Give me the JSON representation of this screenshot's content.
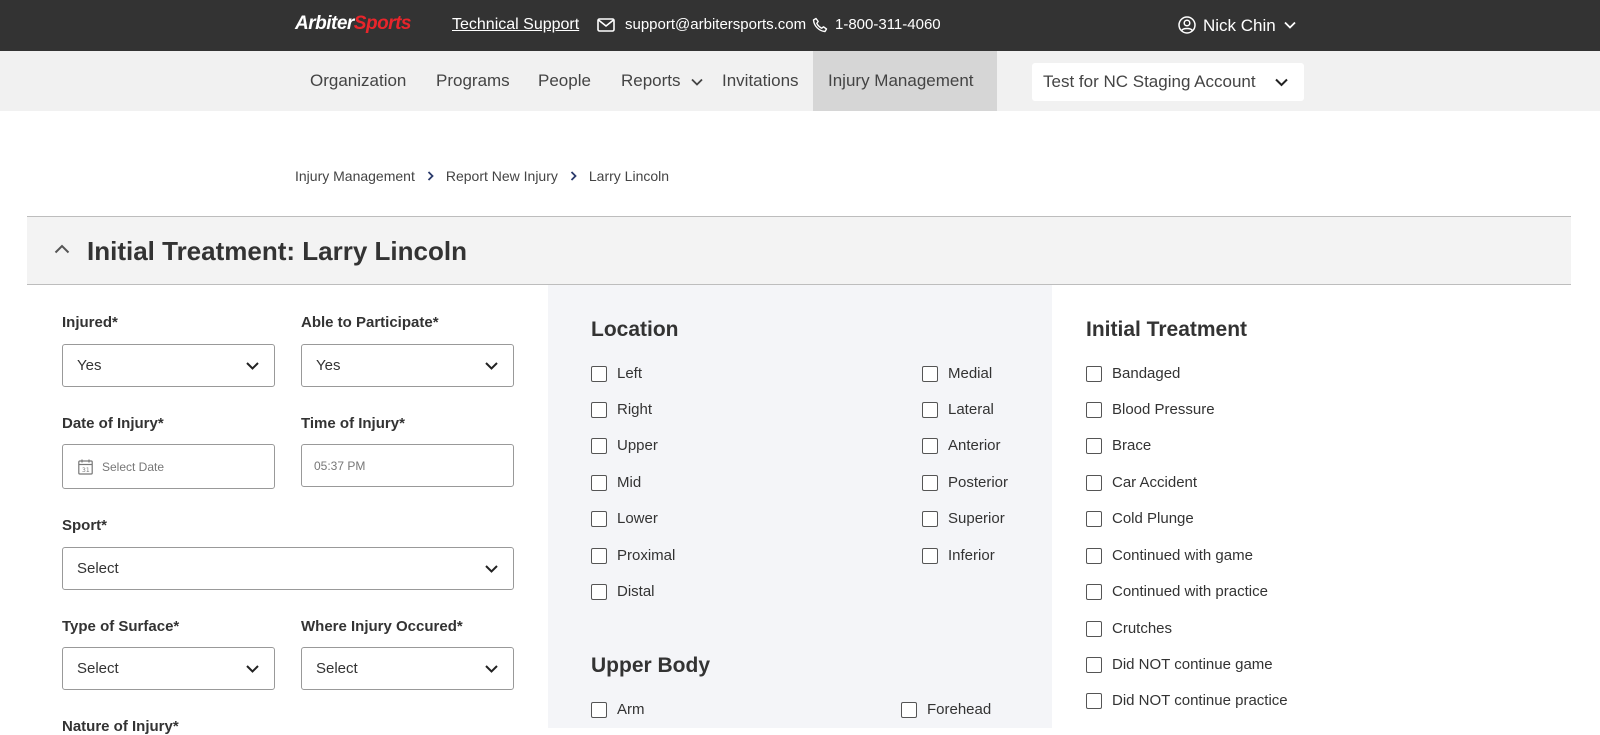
{
  "topbar": {
    "logo_part1": "Arbiter",
    "logo_part2": "Sports",
    "support_link": "Technical Support",
    "email": "support@arbitersports.com",
    "phone": "1-800-311-4060",
    "user_name": "Nick Chin"
  },
  "nav": {
    "items": [
      {
        "label": "Organization"
      },
      {
        "label": "Programs"
      },
      {
        "label": "People"
      },
      {
        "label": "Reports"
      },
      {
        "label": "Invitations"
      },
      {
        "label": "Injury Management"
      }
    ],
    "account": "Test for NC Staging Account"
  },
  "breadcrumb": [
    "Injury Management",
    "Report New Injury",
    "Larry Lincoln"
  ],
  "section": {
    "title": "Initial Treatment: Larry Lincoln"
  },
  "form": {
    "injured_label": "Injured*",
    "injured_value": "Yes",
    "able_label": "Able to Participate*",
    "able_value": "Yes",
    "date_label": "Date of Injury*",
    "date_placeholder": "Select Date",
    "time_label": "Time of Injury*",
    "time_value": "05:37 PM",
    "sport_label": "Sport*",
    "sport_value": "Select",
    "surface_label": "Type of Surface*",
    "surface_value": "Select",
    "where_label": "Where Injury Occured*",
    "where_value": "Select",
    "nature_label": "Nature of Injury*"
  },
  "location": {
    "title": "Location",
    "col1": [
      "Left",
      "Right",
      "Upper",
      "Mid",
      "Lower",
      "Proximal",
      "Distal"
    ],
    "col2": [
      "Medial",
      "Lateral",
      "Anterior",
      "Posterior",
      "Superior",
      "Inferior"
    ]
  },
  "upper_body": {
    "title": "Upper Body",
    "items": [
      "Arm",
      "Forehead"
    ]
  },
  "initial_treatment": {
    "title": "Initial Treatment",
    "items": [
      "Bandaged",
      "Blood Pressure",
      "Brace",
      "Car Accident",
      "Cold Plunge",
      "Continued with game",
      "Continued with practice",
      "Crutches",
      "Did NOT continue game",
      "Did NOT continue practice"
    ]
  },
  "colors": {
    "topbar_bg": "#333333",
    "logo_accent": "#e8252b",
    "nav_bg": "#f1f1f1",
    "nav_active_bg": "#d6d6d6",
    "panel_bg": "#f4f5f8"
  }
}
